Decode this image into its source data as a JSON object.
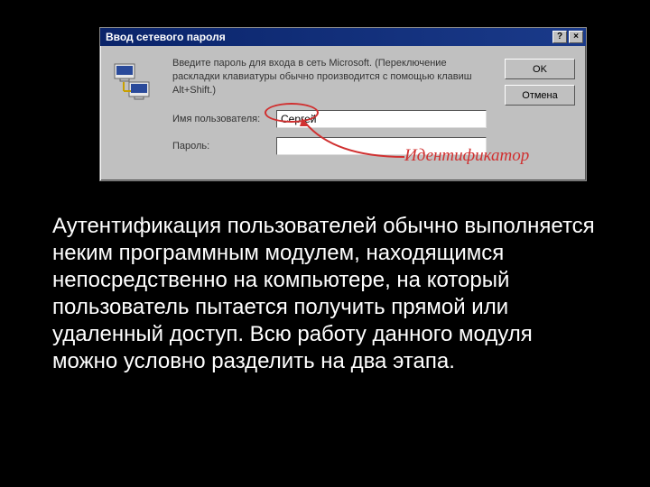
{
  "dialog": {
    "title": "Ввод сетевого пароля",
    "help_btn": "?",
    "close_btn": "×",
    "instruction": "Введите пароль для входа в сеть Microsoft. (Переключение раскладки клавиатуры обычно производится с помощью клавиш Alt+Shift.)",
    "username_label": "Имя пользователя:",
    "username_value": "Сергей",
    "password_label": "Пароль:",
    "password_value": "",
    "ok_label": "OK",
    "cancel_label": "Отмена"
  },
  "annotation": {
    "identifier_label": "Идентификатор"
  },
  "body": {
    "text": "Аутентификация пользователей обычно выполняется неким программным модулем, находящимся непосредственно на компьютере, на который пользователь пытается получить прямой или удаленный доступ. Всю работу данного модуля можно условно разделить на два этапа."
  },
  "colors": {
    "annotation": "#d03030",
    "titlebar": "#0a246a",
    "dialog_bg": "#c0c0c0"
  }
}
